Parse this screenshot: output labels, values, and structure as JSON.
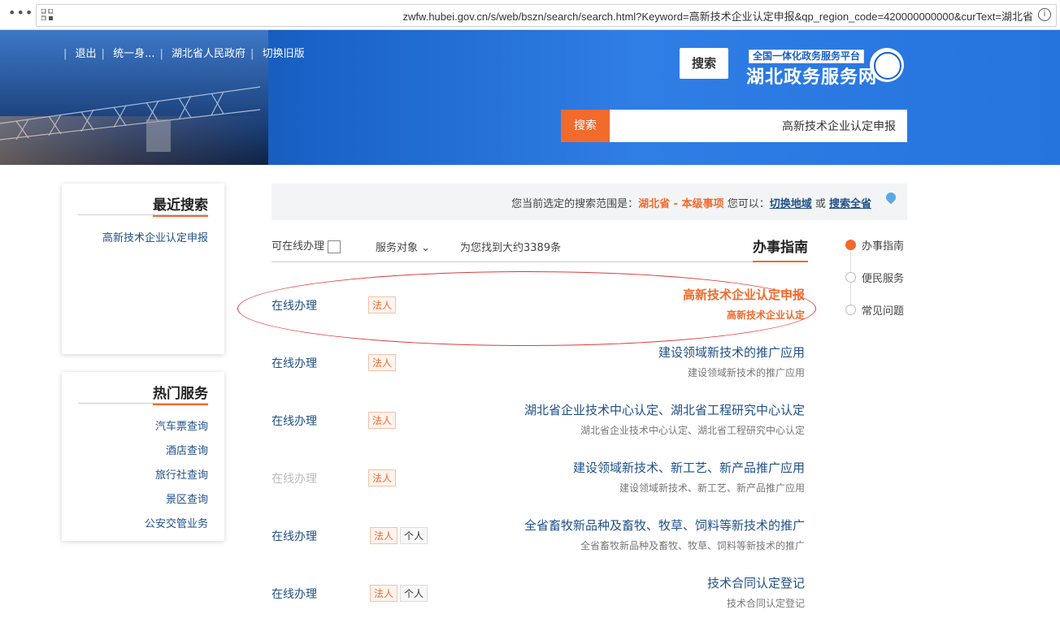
{
  "browser": {
    "url": "zwfw.hubei.gov.cn/s/web/bszn/search/search.html?Keyword=高新技术企业认定申报&qp_region_code=420000000000&curText=湖北省",
    "menu_glyph": "•••",
    "info_glyph": "i"
  },
  "header": {
    "links": [
      "切换旧版",
      "湖北省人民政府",
      "统一身...",
      "退出"
    ],
    "search_button": "搜索",
    "brand_tag": "全国一体化政务服务平台",
    "brand_name": "湖北政务服务网",
    "search_value": "高新技术企业认定申报",
    "search_submit": "搜索"
  },
  "recent_search": {
    "title": "最近搜索",
    "items": [
      "高新技术企业认定申报"
    ]
  },
  "hot_services": {
    "title": "热门服务",
    "items": [
      "汽车票查询",
      "酒店查询",
      "旅行社查询",
      "景区查询",
      "公安交管业务"
    ]
  },
  "scope": {
    "prefix": "您当前选定的搜索范围是：",
    "region": "湖北省 - 本级事项",
    "middle": " 您可以：",
    "switch_region": "切换地域",
    "or": " 或 ",
    "search_all": "搜索全省"
  },
  "filter": {
    "tab_title": "办事指南",
    "count": "为您找到大约3389条",
    "target": "服务对象 ⌄",
    "online_checkbox": "可在线办理"
  },
  "side_nav": [
    "办事指南",
    "便民服务",
    "常见问题"
  ],
  "results": [
    {
      "title": "高新技术企业认定申报",
      "sub": "高新技术企业认定",
      "tags": [
        "法人"
      ],
      "online": "在线办理",
      "online_disabled": false
    },
    {
      "title": "建设领域新技术的推广应用",
      "sub": "建设领域新技术的推广应用",
      "tags": [
        "法人"
      ],
      "online": "在线办理",
      "online_disabled": false
    },
    {
      "title": "湖北省企业技术中心认定、湖北省工程研究中心认定",
      "sub": "湖北省企业技术中心认定、湖北省工程研究中心认定",
      "tags": [
        "法人"
      ],
      "online": "在线办理",
      "online_disabled": false
    },
    {
      "title": "建设领域新技术、新工艺、新产品推广应用",
      "sub": "建设领域新技术、新工艺、新产品推广应用",
      "tags": [
        "法人"
      ],
      "online": "在线办理",
      "online_disabled": true
    },
    {
      "title": "全省畜牧新品种及畜牧、牧草、饲料等新技术的推广",
      "sub": "全省畜牧新品种及畜牧、牧草、饲料等新技术的推广",
      "tags": [
        "个人",
        "法人"
      ],
      "online": "在线办理",
      "online_disabled": false
    },
    {
      "title": "技术合同认定登记",
      "sub": "技术合同认定登记",
      "tags": [
        "个人",
        "法人"
      ],
      "online": "在线办理",
      "online_disabled": false
    }
  ]
}
